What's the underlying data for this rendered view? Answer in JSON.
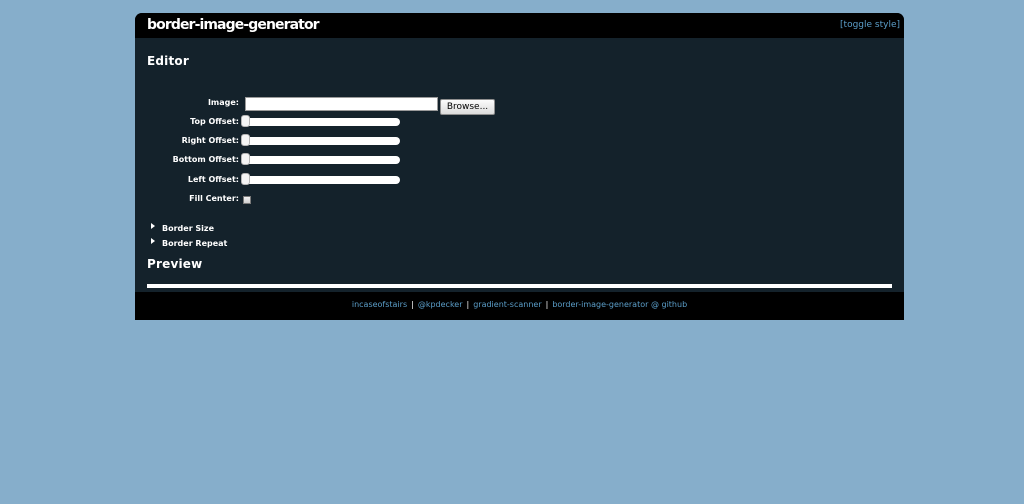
{
  "header": {
    "title": "border-image-generator",
    "toggle_style": "[toggle style]"
  },
  "editor": {
    "heading": "Editor",
    "image_label": "Image:",
    "image_value": "",
    "browse_label": "Browse...",
    "top_offset_label": "Top Offset:",
    "right_offset_label": "Right Offset:",
    "bottom_offset_label": "Bottom Offset:",
    "left_offset_label": "Left Offset:",
    "sliders": {
      "top": 0,
      "right": 0,
      "bottom": 0,
      "left": 0
    },
    "fill_center_label": "Fill Center:",
    "fill_center_checked": false,
    "border_size_label": "Border Size",
    "border_repeat_label": "Border Repeat"
  },
  "preview": {
    "heading": "Preview"
  },
  "footer": {
    "links": [
      "incaseofstairs",
      "@kpdecker",
      "gradient-scanner",
      "border-image-generator @ github"
    ],
    "separator": "|"
  },
  "colors": {
    "page_background": "#86aecb",
    "panel_background": "#14222b",
    "header_background": "#000000",
    "link": "#5b9ec9"
  }
}
